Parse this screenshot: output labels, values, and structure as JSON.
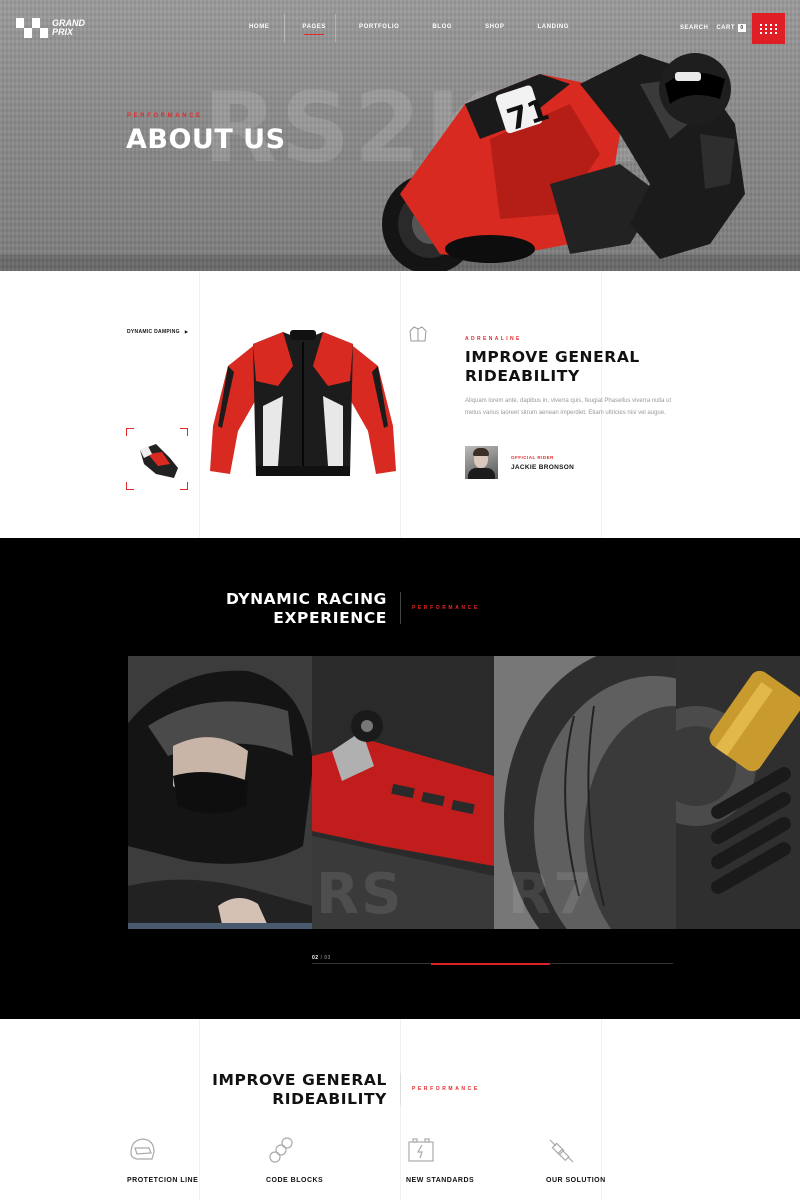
{
  "brand": {
    "line1": "GRAND",
    "line2": "PRIX"
  },
  "nav": {
    "items": [
      {
        "label": "HOME"
      },
      {
        "label": "PAGES"
      },
      {
        "label": "PORTFOLIO"
      },
      {
        "label": "BLOG"
      },
      {
        "label": "SHOP"
      },
      {
        "label": "LANDING"
      }
    ],
    "active": "PAGES",
    "search_label": "SEARCH",
    "cart_label": "CART",
    "cart_count": "0"
  },
  "hero": {
    "subtitle": "PERFORMANCE",
    "title": "ABOUT US",
    "background_text": "RS2K12",
    "bike_number": "71"
  },
  "product": {
    "dynamic_damping_label": "DYNAMIC DAMPING",
    "subtitle": "ADRENALINE",
    "title_line1": "IMPROVE GENERAL",
    "title_line2": "RIDEABILITY",
    "description": "Aliquam lorem ante, dapibus in, viverra quis, feugiat Phasellus viverra nulla ut metus varius laoreet sitrum aenean imperdiet. Etiam ultricies nisi vel augue.",
    "rider_role": "OFFICIAL RIDER",
    "rider_name": "JACKIE BRONSON"
  },
  "racing": {
    "title_line1": "DYNAMIC RACING",
    "title_line2": "EXPERIENCE",
    "subtitle": "PERFORMANCE",
    "gallery_captions": [
      "",
      "RS",
      "R7",
      ""
    ],
    "pager_current": "02",
    "pager_total": "03",
    "progress": 0.33
  },
  "features": {
    "title_line1": "IMPROVE GENERAL",
    "title_line2": "RIDEABILITY",
    "subtitle": "PERFORMANCE",
    "items": [
      {
        "label": "PROTETCION LINE",
        "icon": "helmet-icon"
      },
      {
        "label": "CODE BLOCKS",
        "icon": "chain-icon"
      },
      {
        "label": "NEW STANDARDS",
        "icon": "battery-icon"
      },
      {
        "label": "OUR SOLUTION",
        "icon": "spark-plug-icon"
      }
    ]
  },
  "colors": {
    "accent": "#e01e26",
    "dark": "#000000",
    "text": "#111111",
    "muted": "#9a9a9a"
  }
}
